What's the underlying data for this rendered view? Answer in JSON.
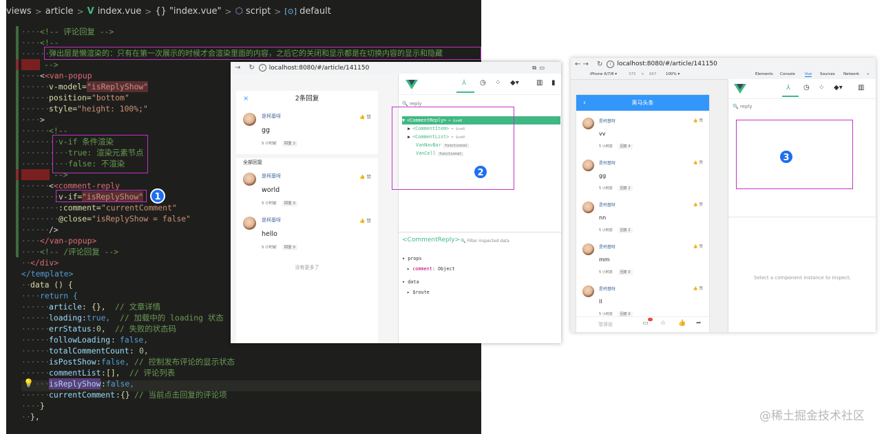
{
  "breadcrumb": [
    "views",
    "article",
    "index.vue",
    "\"index.vue\"",
    "script",
    "default"
  ],
  "code_lines": {
    "l1": "<!-- 评论回复 -->",
    "l2": "<!--",
    "l3": "弹出层是懒渲染的：只有在第一次展示的时候才会渲染里面的内容，之后它的关闭和显示都是在切换内容的显示和隐藏",
    "l4": "-->",
    "l5": "<van-popup",
    "l6_attr": "v-model=",
    "l6_val": "\"isReplyShow\"",
    "l7_attr": "position=",
    "l7_val": "\"bottom\"",
    "l8_attr": "style=",
    "l8_val": "\"height: 100%;\"",
    "l9": ">",
    "l10": "<!--",
    "l11": "v-if 条件渲染",
    "l12": "true: 渲染元素节点",
    "l13": "false: 不渲染",
    "l14": "-->",
    "l15": "<comment-reply",
    "l16_attr": "v-if=",
    "l16_val": "\"isReplyShow\"",
    "l17_attr": ":comment=",
    "l17_val": "\"currentComment\"",
    "l18_attr": "@close=",
    "l18_val": "\"isReplyShow = false\"",
    "l19": "/>",
    "l20": "</van-popup>",
    "l21": "<!-- /评论回复 -->",
    "l22": "</div>",
    "l23": "</template>",
    "l24": "data () {",
    "l25": "return {",
    "l26_k": "article",
    "l26_v": "{},",
    "l26_c": "// 文章详情",
    "l27_k": "loading",
    "l27_v": "true,",
    "l27_c": "// 加载中的 loading 状态",
    "l28_k": "errStatus",
    "l28_v": "0,",
    "l28_c": "// 失败的状态码",
    "l29_k": "followLoading",
    "l29_v": "false,",
    "l30_k": "totalCommentCount",
    "l30_v": "0,",
    "l31_k": "isPostShow",
    "l31_v": "false,",
    "l31_c": "// 控制发布评论的显示状态",
    "l32_k": "commentList",
    "l32_v": "[],",
    "l32_c": "// 评论列表",
    "l33_k": "isReplyShow",
    "l33_v": "false,",
    "l34_k": "currentComment",
    "l34_v": "{}",
    "l34_c": "// 当前点击回复的评论项",
    "l35": "}",
    "l36": "},"
  },
  "badges": {
    "b1": "1",
    "b2": "2",
    "b3": "3"
  },
  "win2": {
    "url": "localhost:8080/#/article/141150",
    "popup_title": "2条回复",
    "close": "×",
    "all_replies": "全部回复",
    "no_more": "没有更多了",
    "comments": [
      {
        "name": "是柯基呀",
        "text": "gg",
        "time": "5 小时前",
        "reply": "回复 2",
        "like": "赞"
      },
      {
        "name": "是柯基呀",
        "text": "world",
        "time": "5 小时前",
        "reply": "回复 0",
        "like": "赞"
      },
      {
        "name": "是柯基呀",
        "text": "hello",
        "time": "5 小时前",
        "reply": "回复 0",
        "like": "赞"
      }
    ],
    "filter": "reply",
    "tree": [
      {
        "label": "<CommentReply>",
        "extra": "= $vm0"
      },
      {
        "label": "<CommentItem>",
        "extra": "= $vm0"
      },
      {
        "label": "<CommentList>",
        "extra": "= $vm0"
      },
      {
        "label": "VanNavBar",
        "extra": "functional"
      },
      {
        "label": "VanCell",
        "extra": "functional"
      }
    ],
    "inspect_title": "<CommentReply>",
    "inspect_filter": "Filter inspected data",
    "props_label": "props",
    "prop_key": "comment:",
    "prop_val": "Object",
    "data_label": "data",
    "data_key": "$route"
  },
  "win3": {
    "url": "localhost:8080/#/article/141150",
    "device": "iPhone 6/7/8 ▾",
    "width": "375",
    "x": "×",
    "height": "667",
    "zoom": "100% ▾",
    "tabs": [
      "Elements",
      "Console",
      "Vue",
      "Sources",
      "Network",
      "»"
    ],
    "header": "黑马头条",
    "comments": [
      {
        "name": "是柯基呀",
        "text": "vv",
        "time": "5 小时前",
        "reply": "回复 4",
        "like": "赞"
      },
      {
        "name": "是柯基呀",
        "text": "gg",
        "time": "5 小时前",
        "reply": "回复 2",
        "like": "赞"
      },
      {
        "name": "是柯基呀",
        "text": "nn",
        "time": "5 小时前",
        "reply": "回复 2",
        "like": "赞"
      },
      {
        "name": "是柯基呀",
        "text": "mm",
        "time": "5 小时前",
        "reply": "回复 0",
        "like": "赞"
      },
      {
        "name": "是柯基呀",
        "text": "ll",
        "time": "5 小时前",
        "reply": "回复 0",
        "like": "赞"
      }
    ],
    "write_comment": "写评论",
    "filter": "reply",
    "select_hint": "Select a component instance to inspect."
  },
  "watermark": "@稀土掘金技术社区",
  "colors": {
    "highlight_box": "#c332c3",
    "badge": "#1e6ef0",
    "vue_green": "#41b883",
    "nav_blue": "#3296fa"
  }
}
